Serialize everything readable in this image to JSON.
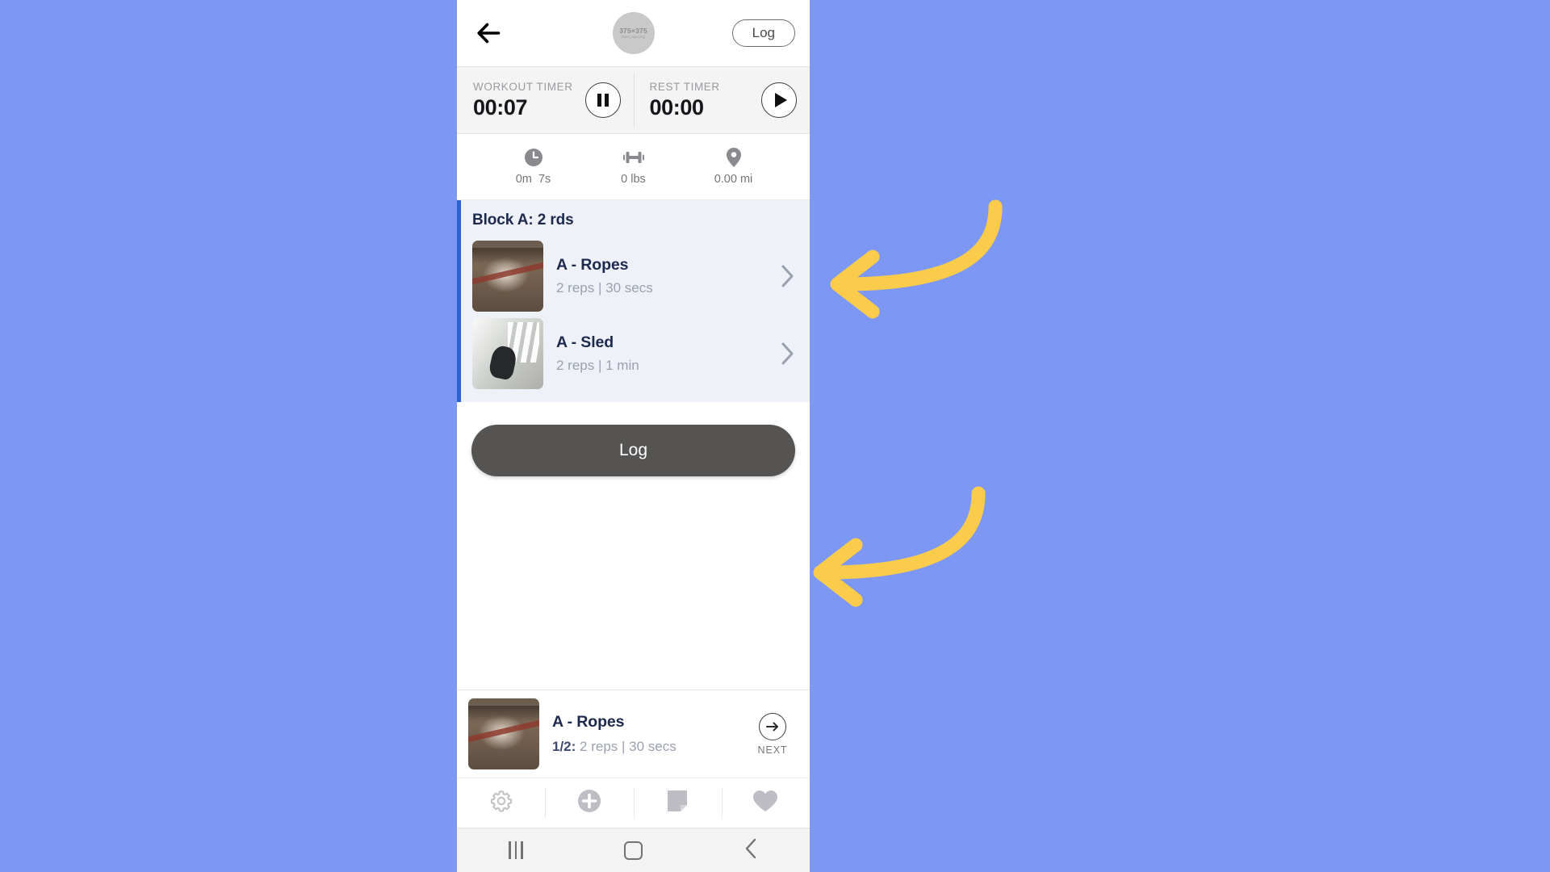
{
  "app": {
    "background_color": "#7d97f4",
    "accent_color": "#2d62d4",
    "annotation_color": "#fbcc4b"
  },
  "appbar": {
    "back_icon": "back-arrow-icon",
    "avatar": {
      "dimensions_label": "375×375",
      "filename_label": "med_logo.png"
    },
    "log_button_label": "Log"
  },
  "timers": [
    {
      "label": "WORKOUT TIMER",
      "value": "00:07",
      "control_icon": "pause-icon",
      "control_name": "pause-workout-timer-button"
    },
    {
      "label": "REST TIMER",
      "value": "00:00",
      "control_icon": "play-icon",
      "control_name": "start-rest-timer-button"
    }
  ],
  "stats": [
    {
      "icon": "clock-icon",
      "value": "0m  7s"
    },
    {
      "icon": "dumbbell-icon",
      "value": "0 lbs"
    },
    {
      "icon": "location-pin-icon",
      "value": "0.00 mi"
    }
  ],
  "block": {
    "title": "Block A: 2 rds",
    "exercises": [
      {
        "name": "A - Ropes",
        "detail": "2 reps | 30 secs",
        "thumbnail": "battle-ropes-thumbnail",
        "chevron_icon": "chevron-right-icon"
      },
      {
        "name": "A - Sled",
        "detail": "2 reps | 1 min",
        "thumbnail": "sled-push-thumbnail",
        "chevron_icon": "chevron-right-icon"
      }
    ]
  },
  "log_action": {
    "label": "Log"
  },
  "current_exercise": {
    "name": "A - Ropes",
    "set_counter": "1/2:",
    "detail": " 2 reps | 30 secs",
    "thumbnail": "battle-ropes-thumbnail",
    "next_label": "NEXT",
    "next_icon": "arrow-right-circle-icon"
  },
  "tools": [
    {
      "icon": "gear-icon",
      "name": "settings-tool"
    },
    {
      "icon": "plus-circle-icon",
      "name": "add-tool"
    },
    {
      "icon": "note-icon",
      "name": "note-tool"
    },
    {
      "icon": "heart-icon",
      "name": "favorite-tool"
    }
  ],
  "android_nav": [
    {
      "icon": "recents-icon",
      "name": "nav-recents-button"
    },
    {
      "icon": "home-icon",
      "name": "nav-home-button"
    },
    {
      "icon": "back-chevron-icon",
      "name": "nav-back-button"
    }
  ],
  "annotations": [
    {
      "name": "annotation-arrow-exercise-chevron",
      "points_to": "A - Ropes chevron"
    },
    {
      "name": "annotation-arrow-next-button",
      "points_to": "NEXT button"
    }
  ]
}
